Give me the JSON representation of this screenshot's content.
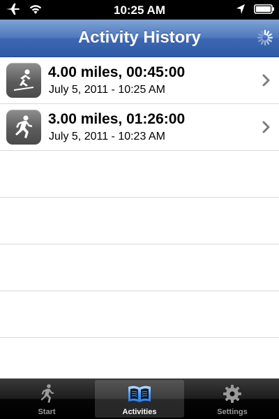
{
  "status_bar": {
    "time": "10:25 AM",
    "icons": [
      "airplane-mode-icon",
      "wifi-icon",
      "location-arrow-icon",
      "battery-icon"
    ]
  },
  "nav_bar": {
    "title": "Activity History",
    "activity_indicator": "loading-spinner-icon"
  },
  "activities": [
    {
      "icon": "skiing-icon",
      "title": "4.00 miles, 00:45:00",
      "subtitle": "July 5, 2011 - 10:25 AM"
    },
    {
      "icon": "running-icon",
      "title": "3.00 miles, 01:26:00",
      "subtitle": "July 5, 2011 - 10:23 AM"
    }
  ],
  "tab_bar": {
    "tabs": [
      {
        "label": "Start",
        "icon": "runner-icon",
        "selected": false
      },
      {
        "label": "Activities",
        "icon": "open-book-icon",
        "selected": true
      },
      {
        "label": "Settings",
        "icon": "gear-icon",
        "selected": false
      }
    ]
  },
  "colors": {
    "nav_bar": "#3d67b1",
    "tab_selected_icon": "#4a9cff",
    "tab_inactive": "#9a9a9a"
  }
}
